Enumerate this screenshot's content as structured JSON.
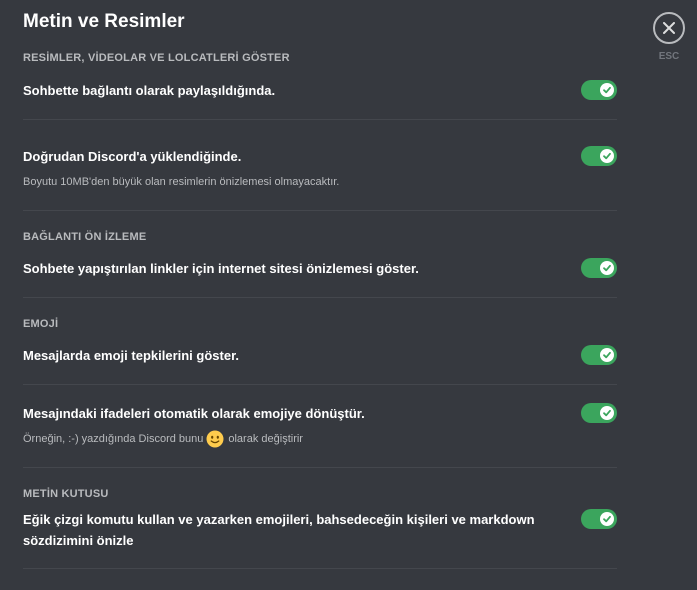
{
  "page_title": "Metin ve Resimler",
  "close": {
    "label": "ESC"
  },
  "colors": {
    "toggle_on": "#3ba55d",
    "background": "#36393f"
  },
  "sections": {
    "media": {
      "title": "RESİMLER, VİDEOLAR VE LOLCATLERİ GÖSTER",
      "link_share": {
        "label": "Sohbette bağlantı olarak paylaşıldığında.",
        "enabled": true
      },
      "uploaded": {
        "label": "Doğrudan Discord'a yüklendiğinde.",
        "note": "Boyutu 10MB'den büyük olan resimlerin önizlemesi olmayacaktır.",
        "enabled": true
      }
    },
    "link_preview": {
      "title": "BAĞLANTI ÖN İZLEME",
      "embed": {
        "label": "Sohbete yapıştırılan linkler için internet sitesi önizlemesi göster.",
        "enabled": true
      }
    },
    "emoji": {
      "title": "EMOJİ",
      "reactions": {
        "label": "Mesajlarda emoji tepkilerini göster.",
        "enabled": true
      },
      "convert": {
        "label": "Mesajındaki ifadeleri otomatik olarak emojiye dönüştür.",
        "note_before": "Örneğin, :-) yazdığında Discord bunu",
        "note_after": "olarak değiştirir",
        "enabled": true
      }
    },
    "textbox": {
      "title": "METİN KUTUSU",
      "preview": {
        "label": "Eğik çizgi komutu kullan ve yazarken emojileri, bahsedeceğin kişileri ve markdown sözdizimini önizle",
        "enabled": true
      }
    }
  }
}
